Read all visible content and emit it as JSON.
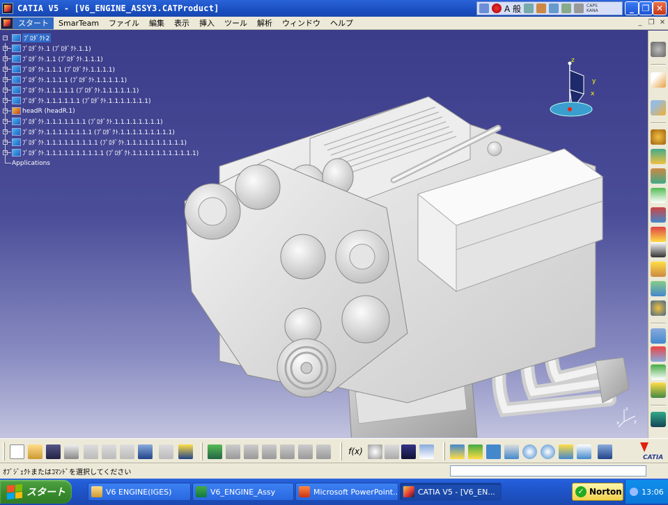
{
  "window": {
    "title": "CATIA V5 - [V6_ENGINE_ASSY3.CATProduct]"
  },
  "ime": {
    "mode_label": "A 般",
    "caps_label": "CAPS",
    "kana_label": "KANA"
  },
  "menu": {
    "items": [
      "スタート",
      "SmarTeam",
      "ファイル",
      "編集",
      "表示",
      "挿入",
      "ツール",
      "解析",
      "ウィンドウ",
      "ヘルプ"
    ]
  },
  "tree": {
    "root": "ﾌﾟﾛﾀﾞｸﾄ2",
    "nodes": [
      "ﾌﾟﾛﾀﾞｸﾄ.1 (ﾌﾟﾛﾀﾞｸﾄ.1.1)",
      "ﾌﾟﾛﾀﾞｸﾄ.1.1 (ﾌﾟﾛﾀﾞｸﾄ.1.1.1)",
      "ﾌﾟﾛﾀﾞｸﾄ.1.1.1 (ﾌﾟﾛﾀﾞｸﾄ.1.1.1.1)",
      "ﾌﾟﾛﾀﾞｸﾄ.1.1.1.1 (ﾌﾟﾛﾀﾞｸﾄ.1.1.1.1.1)",
      "ﾌﾟﾛﾀﾞｸﾄ.1.1.1.1.1 (ﾌﾟﾛﾀﾞｸﾄ.1.1.1.1.1.1)",
      "ﾌﾟﾛﾀﾞｸﾄ.1.1.1.1.1.1 (ﾌﾟﾛﾀﾞｸﾄ.1.1.1.1.1.1.1)",
      "headR (headR.1)",
      "ﾌﾟﾛﾀﾞｸﾄ.1.1.1.1.1.1.1 (ﾌﾟﾛﾀﾞｸﾄ.1.1.1.1.1.1.1.1)",
      "ﾌﾟﾛﾀﾞｸﾄ.1.1.1.1.1.1.1.1 (ﾌﾟﾛﾀﾞｸﾄ.1.1.1.1.1.1.1.1.1)",
      "ﾌﾟﾛﾀﾞｸﾄ.1.1.1.1.1.1.1.1.1 (ﾌﾟﾛﾀﾞｸﾄ.1.1.1.1.1.1.1.1.1.1)",
      "ﾌﾟﾛﾀﾞｸﾄ.1.1.1.1.1.1.1.1.1.1 (ﾌﾟﾛﾀﾞｸﾄ.1.1.1.1.1.1.1.1.1.1.1)"
    ],
    "applications_label": "Applications"
  },
  "compass": {
    "x_label": "x",
    "y_label": "y",
    "z_label": "z"
  },
  "axis_triad": {
    "x_label": "x",
    "y_label": "y",
    "z_label": "z"
  },
  "status": {
    "message": "ｵﾌﾞｼﾞｪｸﾄまたはｺﾏﾝﾄﾞを選択してください",
    "command_value": ""
  },
  "catia_logo": {
    "text": "CATIA"
  },
  "taskbar": {
    "start_label": "スタート",
    "tasks": [
      {
        "label": "V6 ENGINE(IGES)",
        "icon": "folder-icon",
        "active": false
      },
      {
        "label": "V6_ENGINE_Assy",
        "icon": "excel-icon",
        "active": false
      },
      {
        "label": "Microsoft PowerPoint...",
        "icon": "powerpoint-icon",
        "active": false
      },
      {
        "label": "CATIA V5 - [V6_EN...",
        "icon": "catia-icon",
        "active": true
      }
    ],
    "norton_label": "Norton",
    "clock": "13:06"
  },
  "colors": {
    "viewport_top": "#3b3c8a",
    "viewport_bottom": "#c3c4df",
    "selection": "#316ac5",
    "titlebar": "#1a4fc0",
    "taskbar": "#245edb",
    "start_green": "#3a8d2e"
  }
}
